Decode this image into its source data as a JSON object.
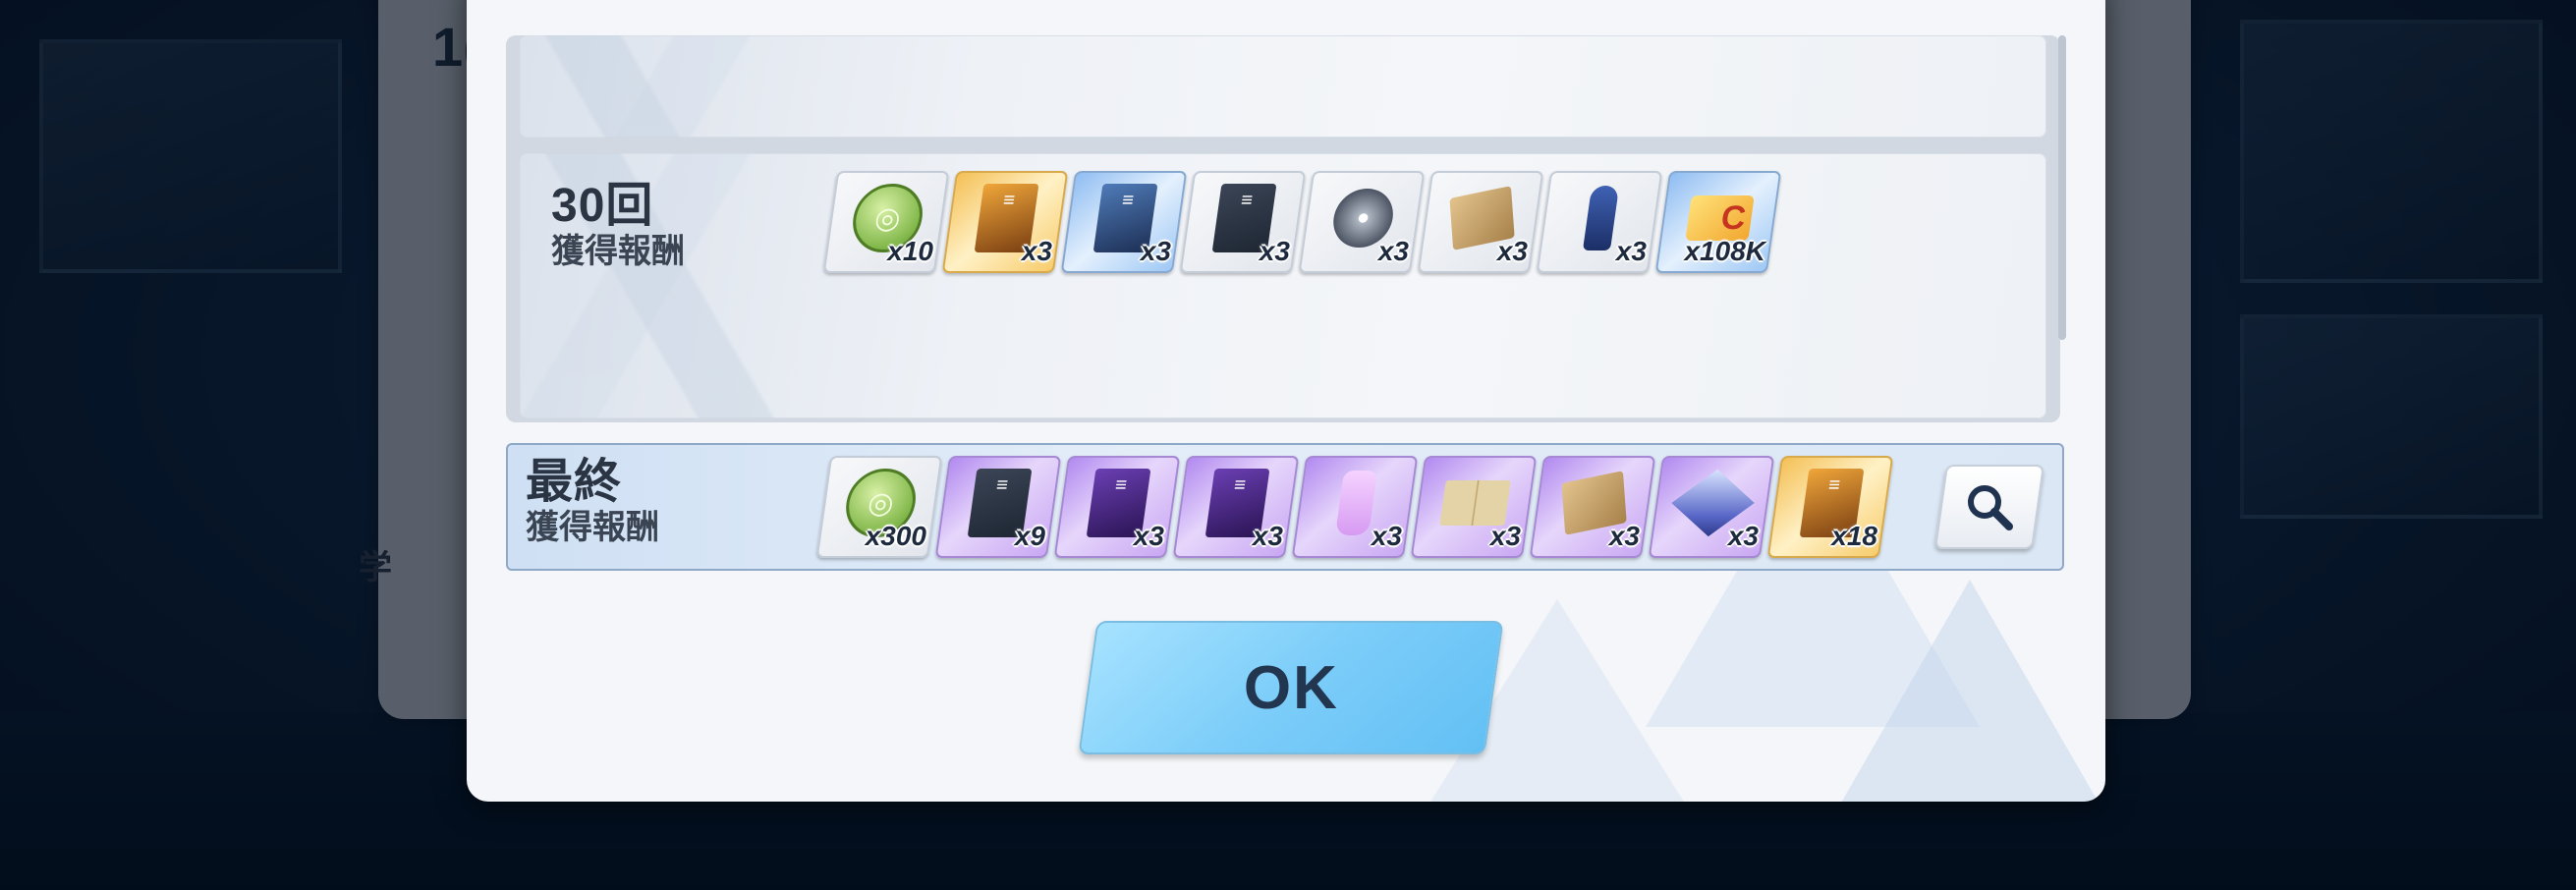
{
  "background": {
    "partial_header_number": "1(",
    "partial_label": "学"
  },
  "rows": [
    {
      "id": "30",
      "title": "30回",
      "subtitle": "獲得報酬",
      "items": [
        {
          "icon": "credit-coin-icon",
          "qty": "x10",
          "rarity": "plain"
        },
        {
          "icon": "gold-tech-note-icon",
          "qty": "x3",
          "rarity": "gold"
        },
        {
          "icon": "blue-tech-note-icon",
          "qty": "x3",
          "rarity": "blue"
        },
        {
          "icon": "tech-note-icon",
          "qty": "x3",
          "rarity": "plain"
        },
        {
          "icon": "disc-artifact-icon",
          "qty": "x3",
          "rarity": "plain"
        },
        {
          "icon": "plant-scroll-icon",
          "qty": "x3",
          "rarity": "plain"
        },
        {
          "icon": "figure-artifact-icon",
          "qty": "x3",
          "rarity": "plain"
        },
        {
          "icon": "credit-card-icon",
          "qty": "x108K",
          "rarity": "blue"
        }
      ]
    }
  ],
  "final": {
    "title": "最終",
    "subtitle": "獲得報酬",
    "items": [
      {
        "icon": "credit-coin-icon",
        "qty": "x300",
        "rarity": "plain"
      },
      {
        "icon": "tech-note-icon",
        "qty": "x9",
        "rarity": "purple"
      },
      {
        "icon": "violet-tech-note-icon",
        "qty": "x3",
        "rarity": "purple"
      },
      {
        "icon": "gear-tech-note-icon",
        "qty": "x3",
        "rarity": "purple"
      },
      {
        "icon": "bottle-artifact-icon",
        "qty": "x3",
        "rarity": "purple"
      },
      {
        "icon": "open-book-artifact-icon",
        "qty": "x3",
        "rarity": "purple"
      },
      {
        "icon": "rune-scroll-icon",
        "qty": "x3",
        "rarity": "purple"
      },
      {
        "icon": "cube-artifact-icon",
        "qty": "x3",
        "rarity": "purple"
      },
      {
        "icon": "gold-tactical-book-icon",
        "qty": "x18",
        "rarity": "gold"
      }
    ]
  },
  "ok_label": "OK",
  "colors": {
    "ok_button": "#7ccdf9",
    "final_border": "#8ea8c8",
    "text_dark": "#2a3442"
  }
}
